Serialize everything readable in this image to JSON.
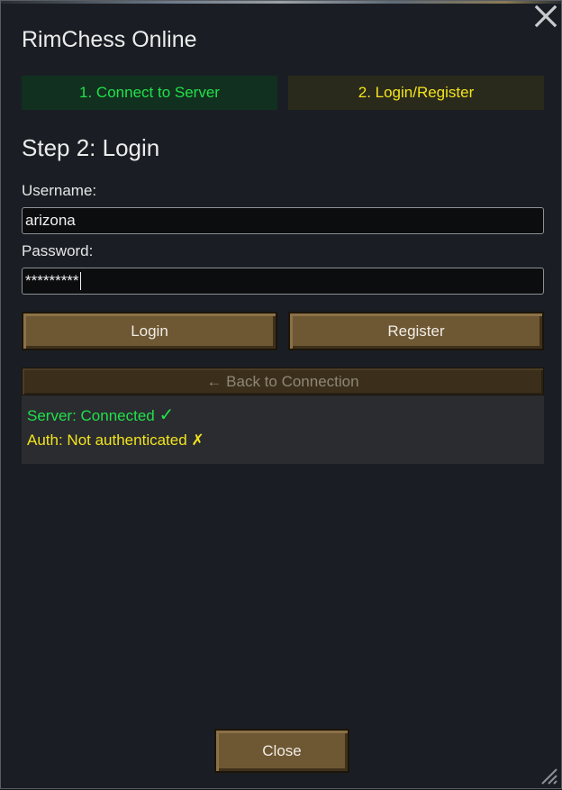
{
  "window": {
    "title": "RimChess Online",
    "close_icon": "close-x-icon",
    "resize_icon": "resize-grip-icon"
  },
  "tabs": [
    {
      "label": "1. Connect to Server",
      "state": "completed",
      "color": "#21e04a"
    },
    {
      "label": "2. Login/Register",
      "state": "active",
      "color": "#f2e31c"
    }
  ],
  "step": {
    "heading": "Step 2: Login"
  },
  "form": {
    "username_label": "Username:",
    "username_value": "arizona",
    "password_label": "Password:",
    "password_value": "*********",
    "login_label": "Login",
    "register_label": "Register",
    "back_label": "← Back to Connection"
  },
  "status": {
    "server_text": "Server: Connected ",
    "server_icon_glyph": "✓",
    "server_color": "#21e04a",
    "auth_text": "Auth: Not authenticated ",
    "auth_icon_glyph": "✗",
    "auth_color": "#f2e31c"
  },
  "footer": {
    "close_label": "Close"
  }
}
